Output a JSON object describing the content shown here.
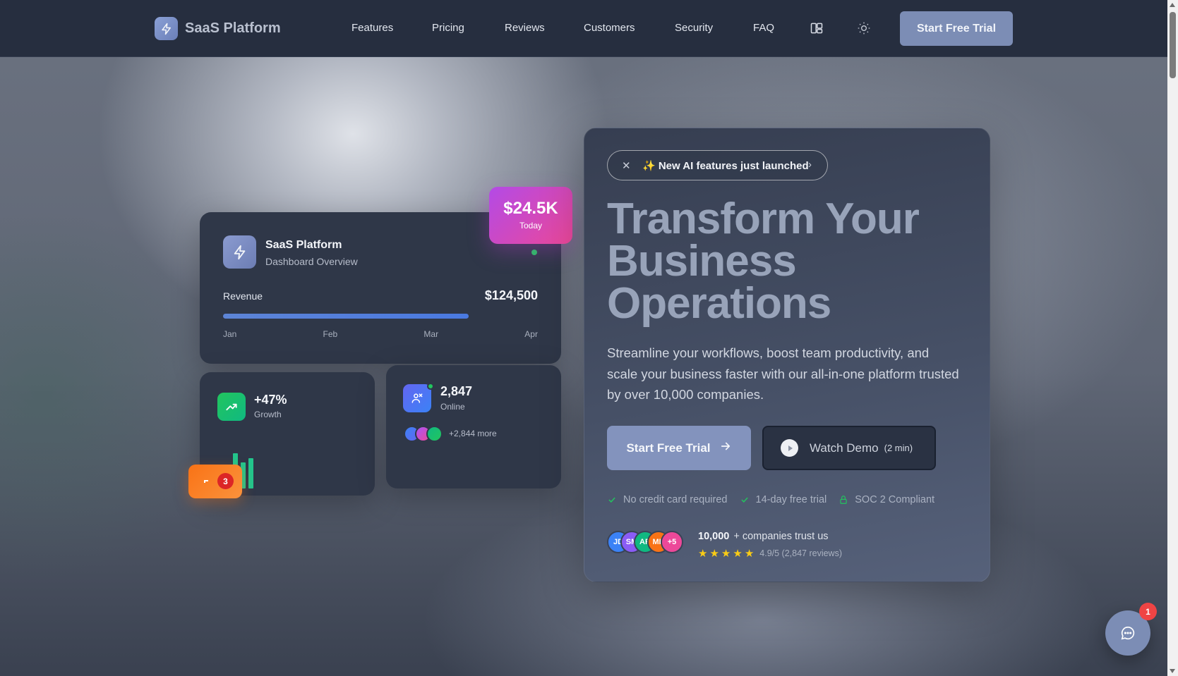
{
  "nav": {
    "brand": "SaaS Platform",
    "links": [
      "Features",
      "Pricing",
      "Reviews",
      "Customers",
      "Security",
      "FAQ"
    ],
    "layout_icon": "layout-columns-icon",
    "theme_icon": "sun-icon",
    "cta": "Start Free Trial"
  },
  "dashboard": {
    "title": "SaaS Platform",
    "subtitle": "Dashboard Overview",
    "revenue_label": "Revenue",
    "revenue_value": "$124,500",
    "revenue_progress_fraction": 0.78,
    "months": [
      "Jan",
      "Feb",
      "Mar",
      "Apr"
    ],
    "today_value": "$24.5K",
    "today_label": "Today"
  },
  "growth": {
    "value": "+47%",
    "label": "Growth",
    "bar_levels": [
      0.2,
      0.45,
      0.8,
      0.6,
      0.7
    ]
  },
  "notification": {
    "count": "3"
  },
  "online": {
    "value": "2,847",
    "label": "Online",
    "more": "+2,844 more"
  },
  "hero": {
    "announcement": "✨ New AI features just launched",
    "headline": "Transform Your Business Operations",
    "lede": "Streamline your workflows, boost team productivity, and scale your business faster with our all-in-one platform trusted by over 10,000 companies.",
    "primary_cta": "Start Free Trial",
    "secondary_cta": "Watch Demo",
    "secondary_duration": "(2 min)",
    "checks": [
      "No credit card required",
      "14-day free trial",
      "SOC 2 Compliant"
    ],
    "avatars": [
      "JD",
      "SM",
      "AR",
      "MK",
      "+5"
    ],
    "trust_count": "10,000",
    "trust_text": "+ companies trust us",
    "rating": "4.9/5 (2,847 reviews)"
  },
  "chat": {
    "badge": "1"
  },
  "colors": {
    "accent": "#7c8db5",
    "nav_bg": "#262e3f",
    "card_bg": "#2f3748",
    "success": "#22c55e",
    "today_gradient_start": "#b34ae6",
    "today_gradient_end": "#ec4899"
  }
}
